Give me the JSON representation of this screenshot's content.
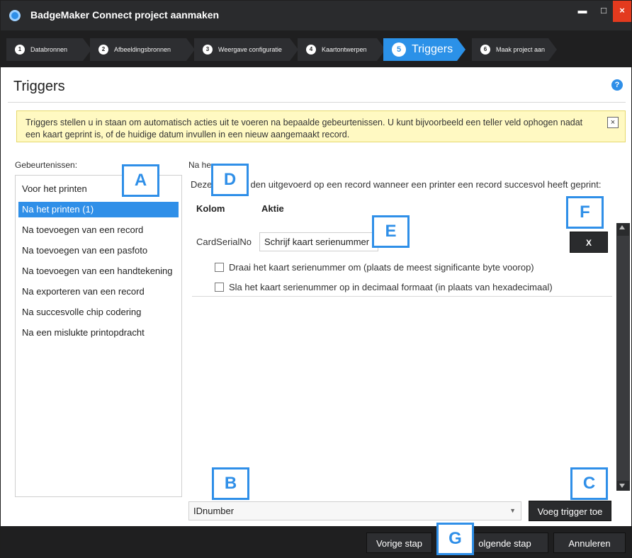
{
  "window": {
    "title": "BadgeMaker Connect project aanmaken",
    "controls": {
      "minimize": "▬",
      "maximize": "□",
      "close": "×"
    }
  },
  "steps": [
    {
      "num": "1",
      "label": "Databronnen"
    },
    {
      "num": "2",
      "label": "Afbeeldingsbronnen"
    },
    {
      "num": "3",
      "label": "Weergave configuratie"
    },
    {
      "num": "4",
      "label": "Kaartontwerpen"
    },
    {
      "num": "5",
      "label": "Triggers",
      "active": true
    },
    {
      "num": "6",
      "label": "Maak project aan"
    }
  ],
  "page": {
    "title": "Triggers",
    "help": "?"
  },
  "info": {
    "text": "Triggers stellen u in staan om automatisch acties uit te voeren na bepaalde gebeurtenissen. U kunt bijvoorbeeld een teller veld ophogen nadat een kaart geprint is, of de huidige datum invullen in een nieuw aangemaakt record.",
    "close": "×"
  },
  "events": {
    "label": "Gebeurtenissen:",
    "items": [
      "Voor het printen",
      "Na het printen (1)",
      "Na toevoegen van een record",
      "Na toevoegen van een pasfoto",
      "Na toevoegen van een handtekening",
      "Na exporteren van een record",
      "Na succesvolle chip codering",
      "Na een mislukte printopdracht"
    ],
    "selected_index": 1
  },
  "trigger_panel": {
    "title": "Na he",
    "description_start": "Deze a",
    "description_end": "den uitgevoerd op een record wanneer een printer een record succesvol heeft geprint:",
    "columns": {
      "kolom": "Kolom",
      "aktie": "Aktie"
    },
    "row": {
      "column_name": "CardSerialNo",
      "action": "Schrijf kaart serienummer",
      "remove": "X",
      "options": [
        "Draai het kaart serienummer om (plaats de meest significante byte voorop)",
        "Sla het kaart serienummer op in decimaal formaat (in plaats van hexadecimaal)"
      ]
    }
  },
  "bottom": {
    "column_select": "IDnumber",
    "add_trigger": "Voeg trigger toe"
  },
  "footer": {
    "previous": "Vorige stap",
    "next": "olgende stap",
    "cancel": "Annuleren"
  },
  "markers": [
    "A",
    "B",
    "C",
    "D",
    "E",
    "F",
    "G"
  ],
  "colors": {
    "accent": "#2f8fe8",
    "dark": "#2a2b2d",
    "info_bg": "#fff9c2"
  }
}
